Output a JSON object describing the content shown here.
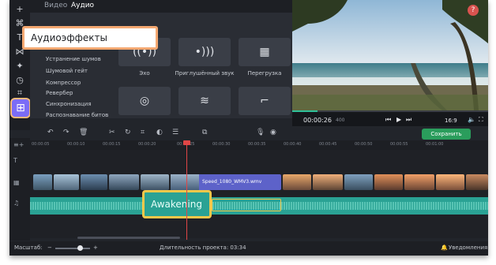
{
  "tabs": [
    {
      "label": "Видео",
      "active": false
    },
    {
      "label": "Аудио",
      "active": true
    }
  ],
  "panel": {
    "callout_title": "Аудиоэффекты",
    "categories": [
      "Устранение шумов",
      "Шумовой гейт",
      "Компрессор",
      "Ревербер",
      "Синхронизация",
      "Распознавание битов"
    ],
    "effects": [
      {
        "label": "Эхо",
        "icon": "echo-icon"
      },
      {
        "label": "Приглушённый звук",
        "icon": "muffled-sound-icon"
      },
      {
        "label": "Перегрузка",
        "icon": "overdrive-icon"
      },
      {
        "label": "",
        "icon": "spiral-icon"
      },
      {
        "label": "",
        "icon": "wave-pattern-icon"
      },
      {
        "label": "",
        "icon": "pipe-icon"
      }
    ]
  },
  "preview": {
    "timecode": "00:00:26",
    "timecode_ms": "400",
    "aspect_ratio": "16:9",
    "help_label": "?"
  },
  "toolbar": {
    "save_label": "Сохранить"
  },
  "timeline": {
    "ruler_ticks": [
      "00:00:05",
      "00:00:10",
      "00:00:15",
      "00:00:20",
      "00:00:25",
      "00:00:30",
      "00:00:35",
      "00:00:40",
      "00:00:45",
      "00:00:50",
      "00:00:55",
      "00:01:00"
    ],
    "video_clip_title": "Speed_1080_WMV3.wmv",
    "audio_clip_title": "Awakening"
  },
  "status": {
    "zoom_label": "Масштаб:",
    "duration_label": "Длительность проекта: 03:34",
    "notifications_label": "Уведомления"
  },
  "colors": {
    "accent": "#7b6cf6",
    "highlight": "#f4a871",
    "audio_track": "#2aa294",
    "video_clip": "#5d62c9",
    "save_button": "#2a9d5c",
    "playhead": "#e04646"
  }
}
